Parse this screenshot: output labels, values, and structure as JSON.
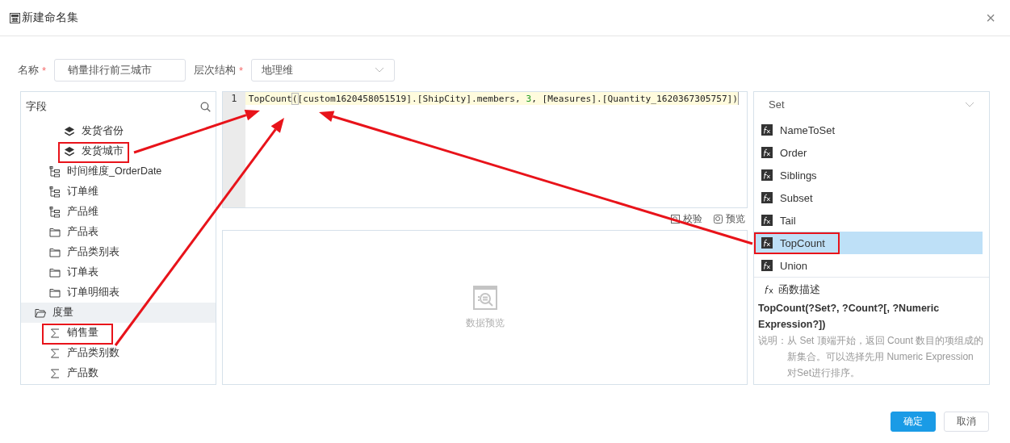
{
  "window": {
    "title": "新建命名集",
    "close": "×"
  },
  "form": {
    "required_mark": "*",
    "name_label": "名称",
    "name_required": true,
    "name_value": "销量排行前三城市",
    "hierarchy_label": "层次结构",
    "hierarchy_required": true,
    "hierarchy_value": "地理维"
  },
  "fields": {
    "title": "字段",
    "tree": [
      {
        "children": [
          {
            "children": [
              {
                "label": "发货省份",
                "kind": "level",
                "selected": false
              },
              {
                "label": "发货城市",
                "kind": "level",
                "selected": false
              }
            ]
          },
          {
            "label": "时间维度_OrderDate",
            "kind": "hierarchy",
            "selected": false
          },
          {
            "label": "订单维",
            "kind": "hierarchy",
            "selected": false
          },
          {
            "label": "产品维",
            "kind": "hierarchy",
            "selected": false
          },
          {
            "label": "产品表",
            "kind": "folder",
            "selected": false
          },
          {
            "label": "产品类别表",
            "kind": "folder",
            "selected": false
          },
          {
            "label": "订单表",
            "kind": "folder",
            "selected": false
          },
          {
            "label": "订单明细表",
            "kind": "folder",
            "selected": false
          }
        ]
      },
      {
        "label": "度量",
        "kind": "open-folder",
        "selected": true,
        "children": [
          {
            "label": "销售量",
            "kind": "measure",
            "selected": false
          },
          {
            "label": "产品类别数",
            "kind": "measure",
            "selected": false
          },
          {
            "label": "产品数",
            "kind": "measure",
            "selected": false
          }
        ]
      }
    ]
  },
  "editor": {
    "line_number": "1",
    "tokens": [
      {
        "kind": "text",
        "text": "TopCount"
      },
      {
        "kind": "bracket",
        "text": "("
      },
      {
        "kind": "text",
        "text": "[custom1620458051519].[ShipCity].members, "
      },
      {
        "kind": "number",
        "text": "3"
      },
      {
        "kind": "text",
        "text": ", [Measures].[Quantity_1620367305757])"
      }
    ]
  },
  "toolbar": {
    "validate": "校验",
    "preview": "预览"
  },
  "preview": {
    "empty_text": "数据预览"
  },
  "functions": {
    "category": "Set",
    "items": [
      {
        "name": "NameToSet",
        "selected": false
      },
      {
        "name": "Order",
        "selected": false
      },
      {
        "name": "Siblings",
        "selected": false
      },
      {
        "name": "Subset",
        "selected": false
      },
      {
        "name": "Tail",
        "selected": false
      },
      {
        "name": "TopCount",
        "selected": true
      },
      {
        "name": "Union",
        "selected": false
      }
    ],
    "description_title": "函数描述",
    "signature": "TopCount(?Set?, ?Count?[, ?Numeric Expression?])",
    "note_label": "说明：",
    "note_text": "从 Set 顶端开始，返回 Count 数目的项组成的新集合。可以选择先用 Numeric Expression 对Set进行排序。"
  },
  "buttons": {
    "ok": "确定",
    "cancel": "取消"
  }
}
